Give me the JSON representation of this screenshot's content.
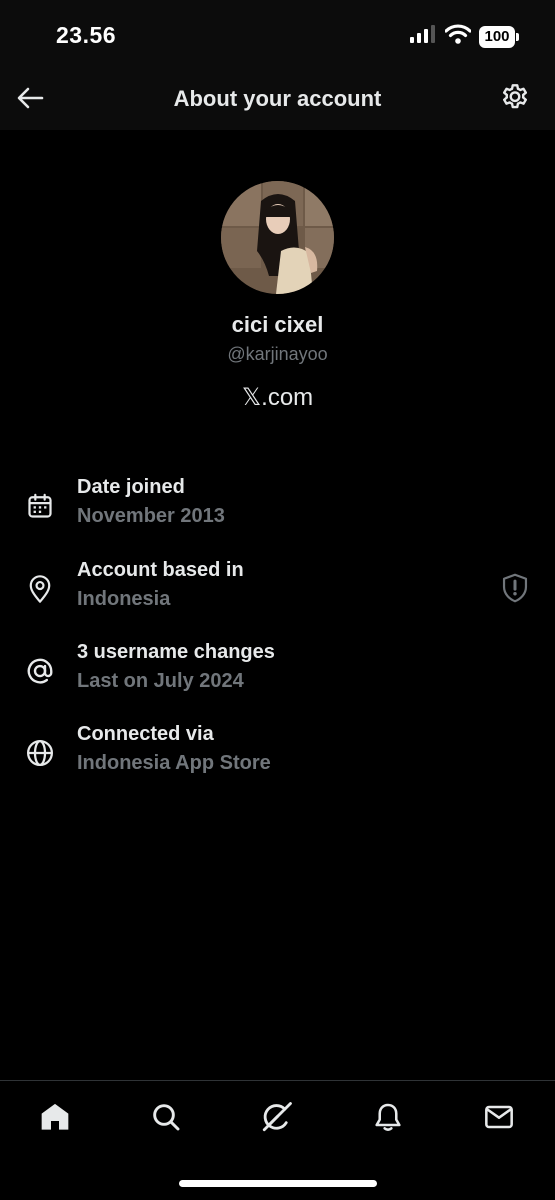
{
  "status_bar": {
    "time": "23.56",
    "battery": "100"
  },
  "header": {
    "title": "About your account",
    "back_icon": "arrow-left-icon",
    "settings_icon": "gear-icon"
  },
  "profile": {
    "display_name": "cici cixel",
    "handle": "@karjinayoo",
    "source": "𝕏.com"
  },
  "info": [
    {
      "icon": "calendar-icon",
      "title": "Date joined",
      "subtitle": "November 2013"
    },
    {
      "icon": "location-pin-icon",
      "title": "Account based in",
      "subtitle": "Indonesia",
      "trailing_icon": "shield-exclamation-icon"
    },
    {
      "icon": "at-sign-icon",
      "title": "3 username changes",
      "subtitle": "Last on July 2024"
    },
    {
      "icon": "globe-icon",
      "title": "Connected via",
      "subtitle": "Indonesia App Store"
    }
  ],
  "bottom_nav": [
    {
      "icon": "home-icon"
    },
    {
      "icon": "search-icon"
    },
    {
      "icon": "grok-icon"
    },
    {
      "icon": "bell-icon"
    },
    {
      "icon": "mail-icon"
    }
  ],
  "colors": {
    "background": "#000000",
    "text_primary": "#e7e9ea",
    "text_secondary": "#71767b"
  }
}
